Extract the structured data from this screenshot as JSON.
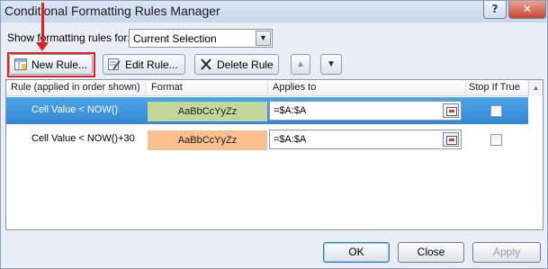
{
  "window": {
    "title": "Conditional Formatting Rules Manager",
    "help_label": "?",
    "close_label": "✕"
  },
  "show_rules": {
    "label": "Show formatting rules for:",
    "selected": "Current Selection",
    "dropdown_icon": "chevron-down-icon"
  },
  "toolbar": {
    "new_rule": "New Rule...",
    "edit_rule": "Edit Rule...",
    "delete_rule": "Delete Rule",
    "move_up": "▲",
    "move_down": "▼"
  },
  "table": {
    "columns": [
      "Rule (applied in order shown)",
      "Format",
      "Applies to",
      "Stop If True"
    ],
    "rows": [
      {
        "rule": "Cell Value < NOW()",
        "format_preview": "AaBbCcYyZz",
        "format_color": "#c4d79b",
        "applies_to": "=$A:$A",
        "stop_if_true": false,
        "selected": true
      },
      {
        "rule": "Cell Value < NOW()+30",
        "format_preview": "AaBbCcYyZz",
        "format_color": "#fabf8f",
        "applies_to": "=$A:$A",
        "stop_if_true": false,
        "selected": false
      }
    ]
  },
  "footer": {
    "ok": "OK",
    "close": "Close",
    "apply": "Apply"
  },
  "colors": {
    "selection": "#3a8fd8",
    "annotation": "#e21e1e"
  }
}
